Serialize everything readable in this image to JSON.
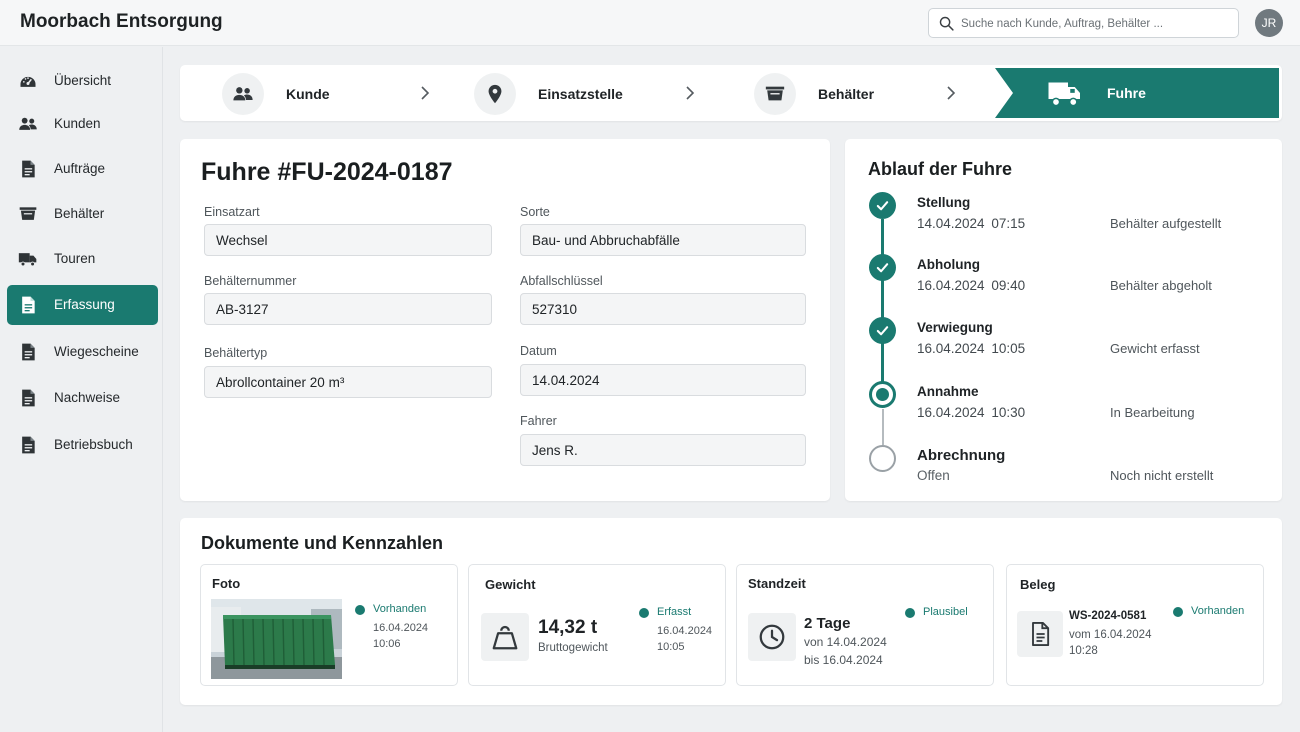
{
  "app": {
    "title": "Moorbach Entsorgung",
    "search_placeholder": "Suche nach Kunde, Auftrag, Behälter ...",
    "user_initials": "JR"
  },
  "sidebar": {
    "items": [
      {
        "label": "Übersicht",
        "icon": "dashboard-icon"
      },
      {
        "label": "Kunden",
        "icon": "users-icon"
      },
      {
        "label": "Aufträge",
        "icon": "document-icon"
      },
      {
        "label": "Behälter",
        "icon": "container-icon"
      },
      {
        "label": "Touren",
        "icon": "truck-icon"
      },
      {
        "label": "Erfassung",
        "icon": "document-icon",
        "active": true
      },
      {
        "label": "Wiegescheine",
        "icon": "document-icon"
      },
      {
        "label": "Nachweise",
        "icon": "document-icon"
      },
      {
        "label": "Betriebsbuch",
        "icon": "document-icon"
      }
    ]
  },
  "stepper": {
    "steps": [
      {
        "label": "Kunde",
        "icon": "users-icon"
      },
      {
        "label": "Einsatzstelle",
        "icon": "location-pin-icon"
      },
      {
        "label": "Behälter",
        "icon": "container-icon"
      },
      {
        "label": "Fuhre",
        "icon": "truck-icon",
        "active": true
      }
    ]
  },
  "form": {
    "title": "Fuhre #FU-2024-0187",
    "einsatzart": {
      "label": "Einsatzart",
      "value": "Wechsel"
    },
    "sorte": {
      "label": "Sorte",
      "value": "Bau- und Abbruchabfälle"
    },
    "behaelternummer": {
      "label": "Behälternummer",
      "value": "AB-3127"
    },
    "abfallschluessel": {
      "label": "Abfallschlüssel",
      "value": "527310"
    },
    "behaeltertyp": {
      "label": "Behältertyp",
      "value": "Abrollcontainer 20 m³"
    },
    "datum": {
      "label": "Datum",
      "value": "14.04.2024"
    },
    "fahrer": {
      "label": "Fahrer",
      "value": "Jens R."
    }
  },
  "timeline": {
    "title": "Ablauf der Fuhre",
    "steps": [
      {
        "name": "Stellung",
        "date": "14.04.2024",
        "time": "07:15",
        "status": "Behälter aufgestellt",
        "state": "done"
      },
      {
        "name": "Abholung",
        "date": "16.04.2024",
        "time": "09:40",
        "status": "Behälter abgeholt",
        "state": "done"
      },
      {
        "name": "Verwiegung",
        "date": "16.04.2024",
        "time": "10:05",
        "status": "Gewicht erfasst",
        "state": "done"
      },
      {
        "name": "Annahme",
        "date": "16.04.2024",
        "time": "10:30",
        "status": "In Bearbeitung",
        "state": "current"
      },
      {
        "name": "Abrechnung",
        "when": "Offen",
        "status": "Noch nicht erstellt",
        "state": "open"
      }
    ]
  },
  "docs": {
    "title": "Dokumente und Kennzahlen",
    "foto": {
      "label": "Foto",
      "status": "Vorhanden",
      "date": "16.04.2024",
      "time": "10:06"
    },
    "gewicht": {
      "label": "Gewicht",
      "value": "14,32 t",
      "sub": "Bruttogewicht",
      "status": "Erfasst",
      "date": "16.04.2024",
      "time": "10:05",
      "icon": "weight-icon"
    },
    "standzeit": {
      "label": "Standzeit",
      "value": "2 Tage",
      "from": "von 14.04.2024",
      "to": "bis 16.04.2024",
      "status": "Plausibel",
      "icon": "clock-icon"
    },
    "beleg": {
      "label": "Beleg",
      "number": "WS-2024-0581",
      "from": "vom 16.04.2024",
      "time": "10:28",
      "status": "Vorhanden",
      "icon": "document-icon"
    }
  },
  "colors": {
    "accent": "#1a7a70"
  }
}
